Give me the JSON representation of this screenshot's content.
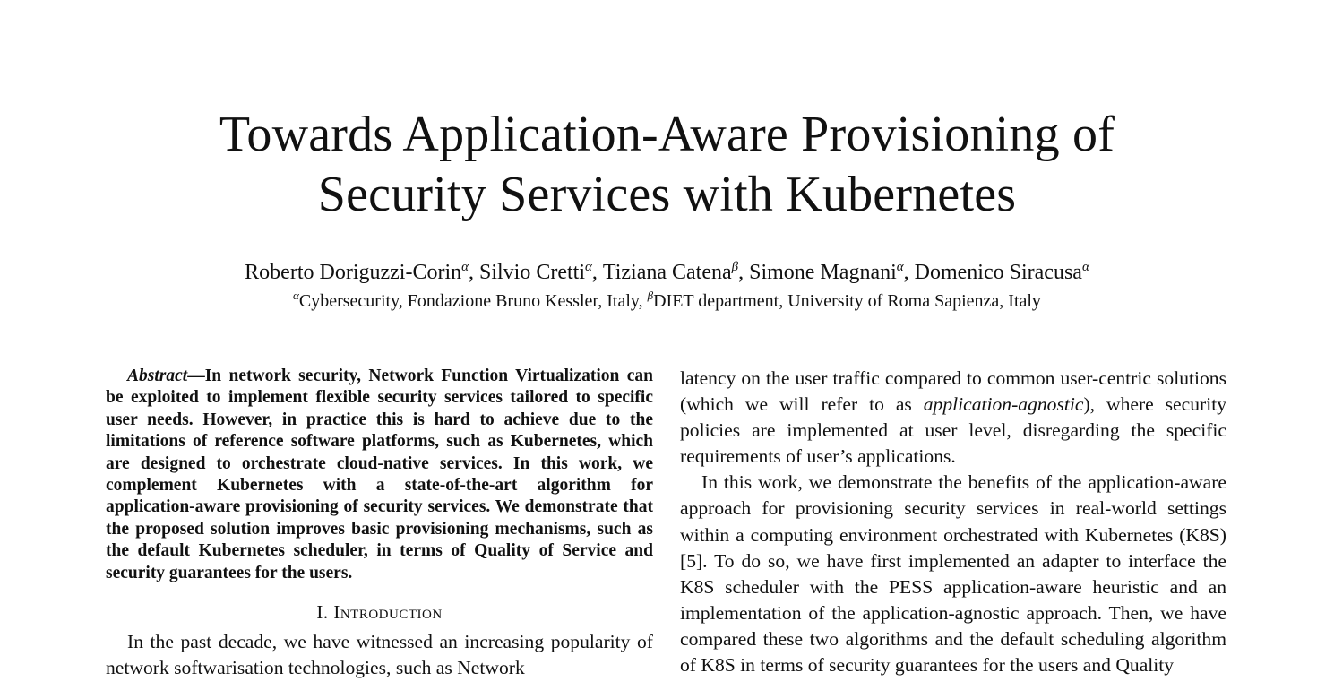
{
  "paper": {
    "title_line1": "Towards Application-Aware Provisioning of",
    "title_line2": "Security Services with Kubernetes",
    "authors": [
      {
        "name": "Roberto Doriguzzi-Corin",
        "mark": "α",
        "sep": ", "
      },
      {
        "name": "Silvio Cretti",
        "mark": "α",
        "sep": ", "
      },
      {
        "name": "Tiziana Catena",
        "mark": "β",
        "sep": ", "
      },
      {
        "name": "Simone Magnani",
        "mark": "α",
        "sep": ", "
      },
      {
        "name": "Domenico Siracusa",
        "mark": "α",
        "sep": ""
      }
    ],
    "affiliations": {
      "alpha_mark": "α",
      "alpha_text": "Cybersecurity, Fondazione Bruno Kessler, Italy, ",
      "beta_mark": "β",
      "beta_text": "DIET department, University of Roma Sapienza, Italy"
    },
    "abstract": {
      "label": "Abstract",
      "dash": "—",
      "text": "In network security, Network Function Virtualization can be exploited to implement flexible security services tailored to specific user needs. However, in practice this is hard to achieve due to the limitations of reference software platforms, such as Kubernetes, which are designed to orchestrate cloud-native services. In this work, we complement Kubernetes with a state-of-the-art algorithm for application-aware provisioning of security services. We demonstrate that the proposed solution improves basic provisioning mechanisms, such as the default Kubernetes scheduler, in terms of Quality of Service and security guarantees for the users."
    },
    "section1": {
      "number": "I. ",
      "title": "Introduction"
    },
    "left_body": "In the past decade, we have witnessed an increasing popularity of network softwarisation technologies, such as Network",
    "right_p1_a": "latency on the user traffic compared to common user-centric solutions (which we will refer to as ",
    "right_p1_em": "application-agnostic",
    "right_p1_b": "), where security policies are implemented at user level, disregarding the specific requirements of user’s applications.",
    "right_p2": "In this work, we demonstrate the benefits of the application-aware approach for provisioning security services in real-world settings within a computing environment orchestrated with Kubernetes (K8S) [5]. To do so, we have first implemented an adapter to interface the K8S scheduler with the PESS application-aware heuristic and an implementation of the application-agnostic approach. Then, we have compared these two algorithms and the default scheduling algorithm of K8S in terms of security guarantees for the users and Quality"
  }
}
